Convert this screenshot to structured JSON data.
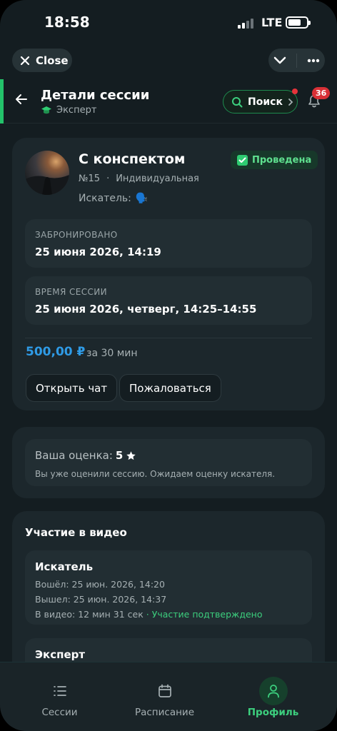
{
  "status_bar": {
    "time": "18:58",
    "network": "LTE"
  },
  "top_controls": {
    "close_label": "Close"
  },
  "header": {
    "title": "Детали сессии",
    "role": "Эксперт",
    "search_label": "Поиск",
    "notifications_count": "36"
  },
  "session": {
    "title": "С конспектом",
    "status": "Проведена",
    "number": "№15",
    "type": "Индивидуальная",
    "seeker_label": "Искатель:",
    "seeker_emoji": "🗣️",
    "booked_label": "ЗАБРОНИРОВАНО",
    "booked_value": "25 июня 2026, 14:19",
    "time_label": "ВРЕМЯ СЕССИИ",
    "time_value": "25 июня 2026, четверг, 14:25–14:55",
    "price": "500,00 ₽",
    "price_per": "за 30 мин",
    "open_chat_label": "Открыть чат",
    "complain_label": "Пожаловаться"
  },
  "rating": {
    "label": "Ваша оценка:",
    "value": "5",
    "note": "Вы уже оценили сессию. Ожидаем оценку искателя."
  },
  "video": {
    "title": "Участие в видео",
    "participants": [
      {
        "name": "Искатель",
        "joined": "Вошёл: 25 июн. 2026, 14:20",
        "left": "Вышел: 25 июн. 2026, 14:37",
        "in_video": "В видео: 12 мин 31 сек",
        "confirmed": "· Участие подтверждено"
      },
      {
        "name": "Эксперт"
      }
    ]
  },
  "bottom_nav": [
    {
      "label": "Сессии",
      "icon": "list-icon"
    },
    {
      "label": "Расписание",
      "icon": "calendar-icon"
    },
    {
      "label": "Профиль",
      "icon": "person-icon",
      "active": true
    }
  ],
  "colors": {
    "accent_green": "#3ccf7e",
    "price_blue": "#2f9be6",
    "badge_red": "#d83036",
    "background": "#141d21"
  }
}
